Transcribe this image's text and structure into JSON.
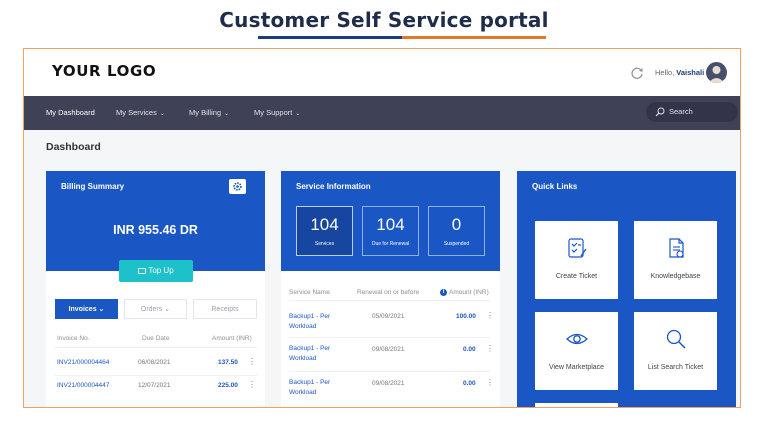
{
  "page_title": "Customer Self Service portal",
  "header": {
    "logo": "YOUR LOGO",
    "greeting": "Hello,",
    "user_name": "Vaishali"
  },
  "nav": {
    "items": [
      {
        "label": "My Dashboard",
        "active": true
      },
      {
        "label": "My Services",
        "chevron": "⌄"
      },
      {
        "label": "My Billing",
        "chevron": "⌄"
      },
      {
        "label": "My Support",
        "chevron": "⌄"
      }
    ],
    "search_label": "Search"
  },
  "breadcrumb": "Dashboard",
  "billing": {
    "title": "Billing Summary",
    "balance": "INR 955.46 DR",
    "topup_label": "Top Up",
    "tabs": [
      {
        "label": "Invoices",
        "chevron": "⌄",
        "active": true
      },
      {
        "label": "Orders",
        "chevron": "⌄"
      },
      {
        "label": "Receipts"
      }
    ],
    "columns": [
      "Invoice No.",
      "Due Date",
      "Amount (INR)"
    ],
    "rows": [
      {
        "invoice": "INV21/000004464",
        "due": "06/08/2021",
        "amount": "137.50"
      },
      {
        "invoice": "INV21/000004447",
        "due": "12/07/2021",
        "amount": "225.00"
      }
    ]
  },
  "service": {
    "title": "Service Information",
    "stats": [
      {
        "value": "104",
        "label": "Services"
      },
      {
        "value": "104",
        "label": "Due for Renewal"
      },
      {
        "value": "0",
        "label": "Suspended"
      }
    ],
    "columns": [
      "Service Name",
      "Renewal on or before",
      "Amount (INR)"
    ],
    "rows": [
      {
        "name_line1": "Backup1 - Per",
        "name_line2": "Workload",
        "renewal": "05/09/2021",
        "amount": "100.00"
      },
      {
        "name_line1": "Backup1 - Per",
        "name_line2": "Workload",
        "renewal": "09/08/2021",
        "amount": "0.00"
      },
      {
        "name_line1": "Backup1 - Per",
        "name_line2": "Workload",
        "renewal": "09/08/2021",
        "amount": "0.00"
      }
    ]
  },
  "quick_links": {
    "title": "Quick Links",
    "items": [
      {
        "label": "Create Ticket",
        "icon": "create-ticket-icon"
      },
      {
        "label": "Knowledgebase",
        "icon": "knowledgebase-icon"
      },
      {
        "label": "View Marketplace",
        "icon": "eye-icon"
      },
      {
        "label": "List Search Ticket",
        "icon": "search-icon"
      }
    ]
  },
  "colors": {
    "primary": "#1a56c4",
    "navbar": "#3f4156",
    "topup": "#1cc1c9",
    "frame_border": "#f0a060"
  }
}
